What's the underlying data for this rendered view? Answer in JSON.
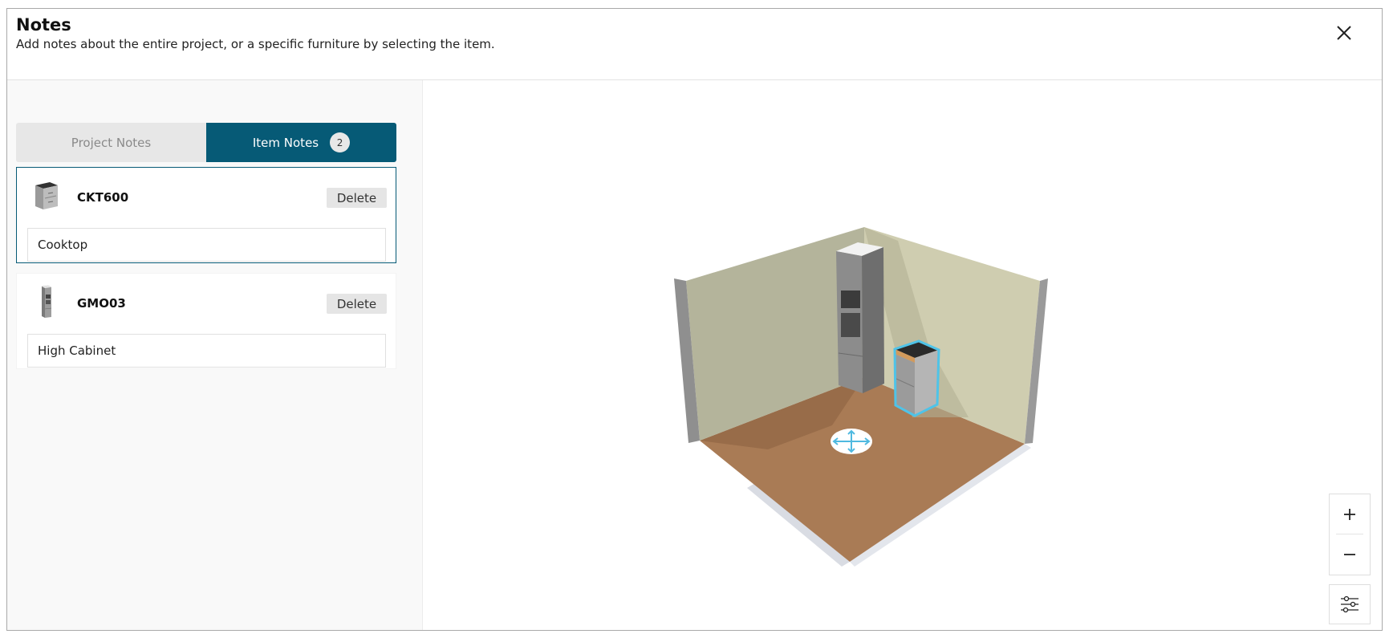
{
  "header": {
    "title": "Notes",
    "subtitle": "Add notes about the entire project, or a specific furniture by selecting the item.",
    "close_icon": "close-icon"
  },
  "tabs": {
    "project_label": "Project Notes",
    "items_label": "Item Notes",
    "items_count": "2",
    "active": "Item Notes"
  },
  "items": [
    {
      "code": "CKT600",
      "delete_label": "Delete",
      "note": "Cooktop",
      "selected": true
    },
    {
      "code": "GMO03",
      "delete_label": "Delete",
      "note": "High Cabinet",
      "selected": false
    }
  ],
  "viewport": {
    "zoom_in_icon": "plus-icon",
    "zoom_out_icon": "minus-icon",
    "settings_icon": "sliders-icon",
    "move_handle_icon": "move-arrows-icon"
  },
  "colors": {
    "accent": "#065a76",
    "selection_outline": "#4fc3e8",
    "wall": "#c9c8a8",
    "floor": "#a97b55"
  }
}
